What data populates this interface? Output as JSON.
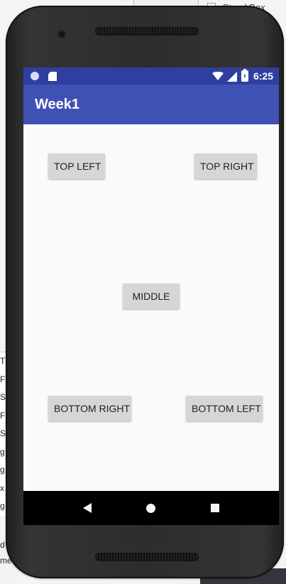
{
  "background_ide": {
    "top_right_text": "Stand Box",
    "left_lines": [
      "T",
      "F",
      "S",
      "F",
      "S",
      "g",
      "g",
      "x",
      "g"
    ],
    "bottom_lines": [
      "d",
      "me"
    ]
  },
  "status_bar": {
    "time": "6:25",
    "icons": [
      "circle-status-icon",
      "sd-card-icon",
      "wifi-icon",
      "cell-signal-icon",
      "battery-charging-icon"
    ]
  },
  "app_bar": {
    "title": "Week1"
  },
  "buttons": {
    "top_left": "TOP LEFT",
    "top_right": "TOP RIGHT",
    "middle": "MIDDLE",
    "bottom_right": "BOTTOM RIGHT",
    "bottom_left": "BOTTOM LEFT"
  },
  "navigation": {
    "icons": [
      "back-icon",
      "home-icon",
      "recent-apps-icon"
    ]
  },
  "colors": {
    "status_bar": "#303f9f",
    "app_bar": "#3f51b5",
    "button": "#d6d6d6",
    "screen": "#fafafa",
    "phone_frame": "#2d2d2d"
  }
}
